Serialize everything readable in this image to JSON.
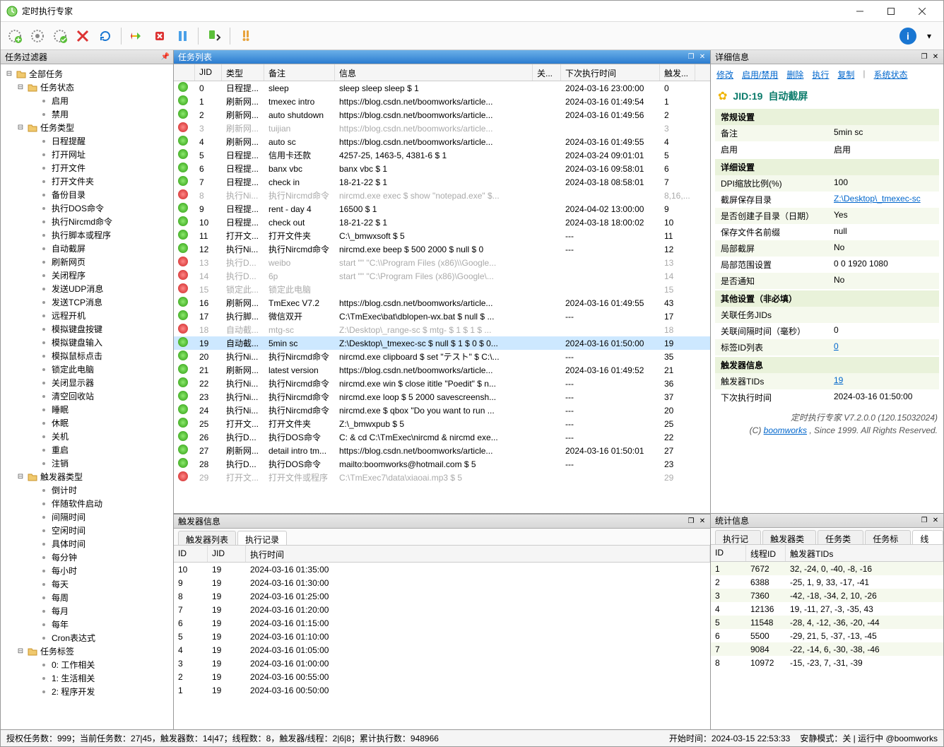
{
  "window": {
    "title": "定时执行专家"
  },
  "panels": {
    "filter": "任务过滤器",
    "tasklist": "任务列表",
    "detail": "详细信息",
    "trigger": "触发器信息",
    "stats": "统计信息"
  },
  "tree": {
    "root": "全部任务",
    "status": {
      "label": "任务状态",
      "items": [
        "启用",
        "禁用"
      ]
    },
    "types": {
      "label": "任务类型",
      "items": [
        "日程提醒",
        "打开网址",
        "打开文件",
        "打开文件夹",
        "备份目录",
        "执行DOS命令",
        "执行Nircmd命令",
        "执行脚本或程序",
        "自动截屏",
        "刷新网页",
        "关闭程序",
        "发送UDP消息",
        "发送TCP消息",
        "远程开机",
        "模拟键盘按键",
        "模拟键盘输入",
        "模拟鼠标点击",
        "锁定此电脑",
        "关闭显示器",
        "清空回收站",
        "睡眠",
        "休眠",
        "关机",
        "重启",
        "注销"
      ]
    },
    "triggers": {
      "label": "触发器类型",
      "items": [
        "倒计时",
        "伴随软件启动",
        "间隔时间",
        "空闲时间",
        "具体时间",
        "每分钟",
        "每小时",
        "每天",
        "每周",
        "每月",
        "每年",
        "Cron表达式"
      ]
    },
    "tags": {
      "label": "任务标签",
      "items": [
        "0: 工作相关",
        "1: 生活相关",
        "2: 程序开发"
      ]
    }
  },
  "grid_headers": {
    "icon": "",
    "jid": "JID",
    "type": "类型",
    "remark": "备注",
    "info": "信息",
    "rel": "关...",
    "next": "下次执行时间",
    "trig": "触发..."
  },
  "tasks": [
    {
      "jid": 0,
      "en": true,
      "type": "日程提...",
      "remark": "sleep",
      "info": "sleep sleep sleep $ 1",
      "next": "2024-03-16 23:00:00",
      "trig": "0"
    },
    {
      "jid": 1,
      "en": true,
      "type": "刷新网...",
      "remark": "tmexec intro",
      "info": "https://blog.csdn.net/boomworks/article...",
      "next": "2024-03-16 01:49:54",
      "trig": "1"
    },
    {
      "jid": 2,
      "en": true,
      "type": "刷新网...",
      "remark": "auto shutdown",
      "info": "https://blog.csdn.net/boomworks/article...",
      "next": "2024-03-16 01:49:56",
      "trig": "2"
    },
    {
      "jid": 3,
      "en": false,
      "type": "刷新网...",
      "remark": "tuijian",
      "info": "https://blog.csdn.net/boomworks/article...",
      "next": "",
      "trig": "3"
    },
    {
      "jid": 4,
      "en": true,
      "type": "刷新网...",
      "remark": "auto sc",
      "info": "https://blog.csdn.net/boomworks/article...",
      "next": "2024-03-16 01:49:55",
      "trig": "4"
    },
    {
      "jid": 5,
      "en": true,
      "type": "日程提...",
      "remark": "信用卡还款",
      "info": "4257-25, 1463-5, 4381-6 $ 1",
      "next": "2024-03-24 09:01:01",
      "trig": "5"
    },
    {
      "jid": 6,
      "en": true,
      "type": "日程提...",
      "remark": "banx vbc",
      "info": "banx vbc $ 1",
      "next": "2024-03-16 09:58:01",
      "trig": "6"
    },
    {
      "jid": 7,
      "en": true,
      "type": "日程提...",
      "remark": "check in",
      "info": "18-21-22 $ 1",
      "next": "2024-03-18 08:58:01",
      "trig": "7"
    },
    {
      "jid": 8,
      "en": false,
      "type": "执行Ni...",
      "remark": "执行Nircmd命令",
      "info": "nircmd.exe exec $ show \"notepad.exe\" $...",
      "next": "",
      "trig": "8,16,..."
    },
    {
      "jid": 9,
      "en": true,
      "type": "日程提...",
      "remark": "rent - day 4",
      "info": "16500 $ 1",
      "next": "2024-04-02 13:00:00",
      "trig": "9"
    },
    {
      "jid": 10,
      "en": true,
      "type": "日程提...",
      "remark": "check out",
      "info": "18-21-22 $ 1",
      "next": "2024-03-18 18:00:02",
      "trig": "10"
    },
    {
      "jid": 11,
      "en": true,
      "type": "打开文...",
      "remark": "打开文件夹",
      "info": "C:\\_bmwxsoft $ 5",
      "next": "---",
      "trig": "11"
    },
    {
      "jid": 12,
      "en": true,
      "type": "执行Ni...",
      "remark": "执行Nircmd命令",
      "info": "nircmd.exe beep $ 500 2000 $ null $ 0",
      "next": "---",
      "trig": "12"
    },
    {
      "jid": 13,
      "en": false,
      "type": "执行D...",
      "remark": "weibo",
      "info": "start \"\" \"C:\\\\Program Files (x86)\\\\Google...",
      "next": "",
      "trig": "13"
    },
    {
      "jid": 14,
      "en": false,
      "type": "执行D...",
      "remark": "6p",
      "info": "start \"\" \"C:\\Program Files (x86)\\Google\\...",
      "next": "",
      "trig": "14"
    },
    {
      "jid": 15,
      "en": false,
      "type": "锁定此...",
      "remark": "锁定此电脑",
      "info": "",
      "next": "",
      "trig": "15"
    },
    {
      "jid": 16,
      "en": true,
      "type": "刷新网...",
      "remark": "TmExec V7.2",
      "info": "https://blog.csdn.net/boomworks/article...",
      "next": "2024-03-16 01:49:55",
      "trig": "43"
    },
    {
      "jid": 17,
      "en": true,
      "type": "执行脚...",
      "remark": "微信双开",
      "info": "C:\\TmExec\\bat\\dblopen-wx.bat $ null $ ...",
      "next": "---",
      "trig": "17"
    },
    {
      "jid": 18,
      "en": false,
      "type": "自动截...",
      "remark": "mtg-sc",
      "info": "Z:\\Desktop\\_range-sc $ mtg- $ 1 $ 1 $ ...",
      "next": "",
      "trig": "18"
    },
    {
      "jid": 19,
      "en": true,
      "sel": true,
      "type": "自动截...",
      "remark": "5min sc",
      "info": "Z:\\Desktop\\_tmexec-sc $ null $ 1 $ 0 $ 0...",
      "next": "2024-03-16 01:50:00",
      "trig": "19"
    },
    {
      "jid": 20,
      "en": true,
      "type": "执行Ni...",
      "remark": "执行Nircmd命令",
      "info": "nircmd.exe clipboard $ set \"テスト\" $ C:\\...",
      "next": "---",
      "trig": "35"
    },
    {
      "jid": 21,
      "en": true,
      "type": "刷新网...",
      "remark": "latest version",
      "info": "https://blog.csdn.net/boomworks/article...",
      "next": "2024-03-16 01:49:52",
      "trig": "21"
    },
    {
      "jid": 22,
      "en": true,
      "type": "执行Ni...",
      "remark": "执行Nircmd命令",
      "info": "nircmd.exe win $ close ititle \"Poedit\" $ n...",
      "next": "---",
      "trig": "36"
    },
    {
      "jid": 23,
      "en": true,
      "type": "执行Ni...",
      "remark": "执行Nircmd命令",
      "info": "nircmd.exe loop $ 5 2000 savescreensh...",
      "next": "---",
      "trig": "37"
    },
    {
      "jid": 24,
      "en": true,
      "type": "执行Ni...",
      "remark": "执行Nircmd命令",
      "info": "nircmd.exe $ qbox \"Do you want to run ...",
      "next": "---",
      "trig": "20"
    },
    {
      "jid": 25,
      "en": true,
      "type": "打开文...",
      "remark": "打开文件夹",
      "info": "Z:\\_bmwxpub $ 5",
      "next": "---",
      "trig": "25"
    },
    {
      "jid": 26,
      "en": true,
      "type": "执行D...",
      "remark": "执行DOS命令",
      "info": "C: & cd C:\\TmExec\\nircmd & nircmd exe...",
      "next": "---",
      "trig": "22"
    },
    {
      "jid": 27,
      "en": true,
      "type": "刷新网...",
      "remark": "detail intro tm...",
      "info": "https://blog.csdn.net/boomworks/article...",
      "next": "2024-03-16 01:50:01",
      "trig": "27"
    },
    {
      "jid": 28,
      "en": true,
      "type": "执行D...",
      "remark": "执行DOS命令",
      "info": "mailto:boomworks@hotmail.com $ 5",
      "next": "---",
      "trig": "23"
    },
    {
      "jid": 29,
      "en": false,
      "type": "打开文...",
      "remark": "打开文件或程序",
      "info": "C:\\TmExec7\\data\\xiaoai.mp3 $ 5",
      "next": "",
      "trig": "29"
    }
  ],
  "detail": {
    "actions": {
      "edit": "修改",
      "toggle": "启用/禁用",
      "delete": "删除",
      "run": "执行",
      "copy": "复制",
      "sysstate": "系统状态"
    },
    "jid_label": "JID:19",
    "jid_name": "自动截屏",
    "s1": "常规设置",
    "s1rows": [
      [
        "备注",
        "5min sc"
      ],
      [
        "启用",
        "启用"
      ]
    ],
    "s2": "详细设置",
    "s2rows": [
      [
        "DPI缩放比例(%)",
        "100"
      ],
      [
        "截屏保存目录",
        "Z:\\Desktop\\_tmexec-sc",
        true
      ],
      [
        "是否创建子目录（日期）",
        "Yes"
      ],
      [
        "保存文件名前缀",
        "null"
      ],
      [
        "局部截屏",
        "No"
      ],
      [
        "局部范围设置",
        "0 0 1920 1080"
      ],
      [
        "是否通知",
        "No"
      ]
    ],
    "s3": "其他设置（非必填）",
    "s3rows": [
      [
        "关联任务JIDs",
        ""
      ],
      [
        "关联间隔时间（毫秒）",
        "0"
      ],
      [
        "标签ID列表",
        "0",
        true
      ]
    ],
    "s4": "触发器信息",
    "s4rows": [
      [
        "触发器TIDs",
        "19",
        true
      ],
      [
        "下次执行时间",
        "2024-03-16 01:50:00"
      ]
    ],
    "version": "定时执行专家 V7.2.0.0 (120.15032024)",
    "copyright_pre": "(C) ",
    "copyright_link": "boomworks",
    "copyright_post": " , Since 1999. All Rights Reserved."
  },
  "trigger_tabs": [
    "触发器列表",
    "执行记录"
  ],
  "trigger_headers": {
    "id": "ID",
    "jid": "JID",
    "time": "执行时间"
  },
  "trigger_rows": [
    [
      "10",
      "19",
      "2024-03-16 01:35:00"
    ],
    [
      "9",
      "19",
      "2024-03-16 01:30:00"
    ],
    [
      "8",
      "19",
      "2024-03-16 01:25:00"
    ],
    [
      "7",
      "19",
      "2024-03-16 01:20:00"
    ],
    [
      "6",
      "19",
      "2024-03-16 01:15:00"
    ],
    [
      "5",
      "19",
      "2024-03-16 01:10:00"
    ],
    [
      "4",
      "19",
      "2024-03-16 01:05:00"
    ],
    [
      "3",
      "19",
      "2024-03-16 01:00:00"
    ],
    [
      "2",
      "19",
      "2024-03-16 00:55:00"
    ],
    [
      "1",
      "19",
      "2024-03-16 00:50:00"
    ]
  ],
  "stat_tabs": [
    "执行记录",
    "触发器类型",
    "任务类型",
    "任务标签",
    "线程"
  ],
  "stat_headers": {
    "id": "ID",
    "tid": "线程ID",
    "tids": "触发器TIDs"
  },
  "stat_rows": [
    [
      "1",
      "7672",
      "32, -24, 0, -40, -8, -16"
    ],
    [
      "2",
      "6388",
      "-25, 1, 9, 33, -17, -41"
    ],
    [
      "3",
      "7360",
      "-42, -18, -34, 2, 10, -26"
    ],
    [
      "4",
      "12136",
      "19, -11, 27, -3, -35, 43"
    ],
    [
      "5",
      "11548",
      "-28, 4, -12, -36, -20, -44"
    ],
    [
      "6",
      "5500",
      "-29, 21, 5, -37, -13, -45"
    ],
    [
      "7",
      "9084",
      "-22, -14, 6, -30, -38, -46"
    ],
    [
      "8",
      "10972",
      "-15, -23, 7, -31, -39"
    ]
  ],
  "statusbar": {
    "left": "授权任务数：999；当前任务数：27|45，触发器数：14|47；线程数：8，触发器/线程：2|6|8；累计执行数：948966",
    "start": "开始时间：2024-03-15 22:53:33",
    "mode": "安静模式：关 | 运行中 @boomworks"
  }
}
